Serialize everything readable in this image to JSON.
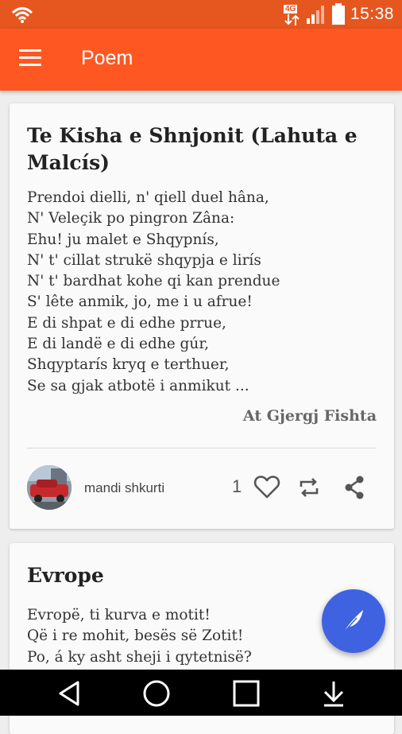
{
  "status_bar": {
    "time": "15:38",
    "network_label": "4G",
    "icons": [
      "wifi-icon",
      "signal-icon",
      "battery-icon"
    ]
  },
  "app_bar": {
    "title": "Poem",
    "menu_icon": "menu-icon"
  },
  "poems": [
    {
      "title": "Te Kisha e Shnjonit (Lahuta e Malcís)",
      "lines": [
        "Prendoi dielli, n' qiell duel hâna,",
        "N' Veleçik po pingron Zâna:",
        "Ehu! ju malet e Shqypnís,",
        "N' t' cillat strukë shqypja e lirís",
        "N' t' bardhat kohe qi kan prendue",
        "S' lête anmik, jo, me i u afrue!",
        "E di shpat e di edhe prrue,",
        "E di landë e di edhe gúr,",
        "Shqyptarís kryq e terthuer,",
        "Se sa gjak atbotë i anmikut ..."
      ],
      "author": "At Gjergj Fishta",
      "user": "mandi shkurti",
      "likes": "1"
    },
    {
      "title": "Evrope",
      "lines": [
        "Evropë, ti kurva e motit!",
        "Që i re mohit, besës së Zotit!",
        "Po, á ky asht sheji i qytetnisë?"
      ]
    }
  ],
  "colors": {
    "status_bar": "#e6561f",
    "app_bar": "#ff5722",
    "fab": "#3f62e0",
    "nav_bar": "#000000"
  },
  "fab_icon": "feather-icon",
  "nav_icons": [
    "back-icon",
    "home-icon",
    "recents-icon",
    "download-icon"
  ]
}
